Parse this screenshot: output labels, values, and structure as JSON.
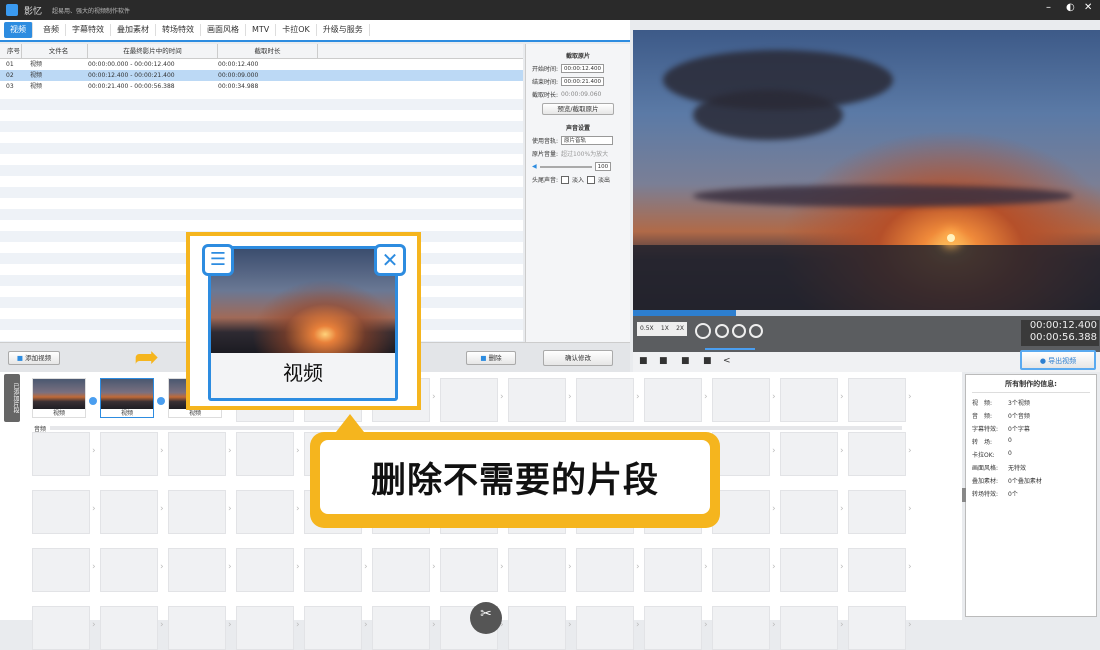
{
  "app": {
    "title": "影忆",
    "subtitle": "超易用、强大的视频制作软件"
  },
  "tabs": [
    "视频",
    "音频",
    "字幕特效",
    "叠加素材",
    "转场特效",
    "画面风格",
    "MTV",
    "卡拉OK",
    "升级与服务"
  ],
  "table": {
    "headers": [
      "序号",
      "文件名",
      "在最终影片中的时间",
      "截取时长"
    ],
    "rows": [
      [
        "01",
        "视频",
        "00:00:00.000 - 00:00:12.400",
        "00:00:12.400"
      ],
      [
        "02",
        "视频",
        "00:00:12.400 - 00:00:21.400",
        "00:00:09.000"
      ],
      [
        "03",
        "视频",
        "00:00:21.400 - 00:00:56.388",
        "00:00:34.988"
      ]
    ]
  },
  "settings": {
    "cut_title": "截取原片",
    "start_label": "开始时间:",
    "start": "00:00:12.400",
    "end_label": "结束时间:",
    "end": "00:00:21.400",
    "dur_label": "截取时长:",
    "dur": "00:00:09.060",
    "preview_btn": "预览/截取原片",
    "sound_title": "声音设置",
    "track_label": "使用音轨:",
    "track": "原片音轨",
    "vol_label": "原片音量:",
    "vol_hint": "超过100%为放大",
    "vol": "100",
    "fade_label": "头尾声音:",
    "fade_in": "淡入",
    "fade_out": "淡出"
  },
  "buttons": {
    "add_video": "添加视频",
    "delete": "删除",
    "confirm": "确认修改",
    "export": "导出视频"
  },
  "player": {
    "current": "00:00:12.400",
    "total": "00:00:56.388",
    "speed_a": "0.5X",
    "speed_b": "1X",
    "speed_c": "2X",
    "progress": 0.22
  },
  "timeline": {
    "side_tab": "已添加片段",
    "clips": [
      "视频",
      "视频",
      "视频"
    ],
    "audio_label": "音频"
  },
  "info": {
    "title": "所有制作的信息:",
    "rows": [
      [
        "视　频:",
        "3个视频"
      ],
      [
        "音　频:",
        "0个音频"
      ],
      [
        "字幕特效:",
        "0个字幕"
      ],
      [
        "转　场:",
        "0"
      ],
      [
        "卡拉OK:",
        "0"
      ],
      [
        "画面风格:",
        "无特效"
      ],
      [
        "叠加素材:",
        "0个叠加素材"
      ],
      [
        "转场特效:",
        "0个"
      ]
    ]
  },
  "popup": {
    "label": "视频"
  },
  "callout": {
    "text": "删除不需要的片段"
  },
  "colors": {
    "accent": "#2d8ce0",
    "highlight": "#f5b51e"
  }
}
